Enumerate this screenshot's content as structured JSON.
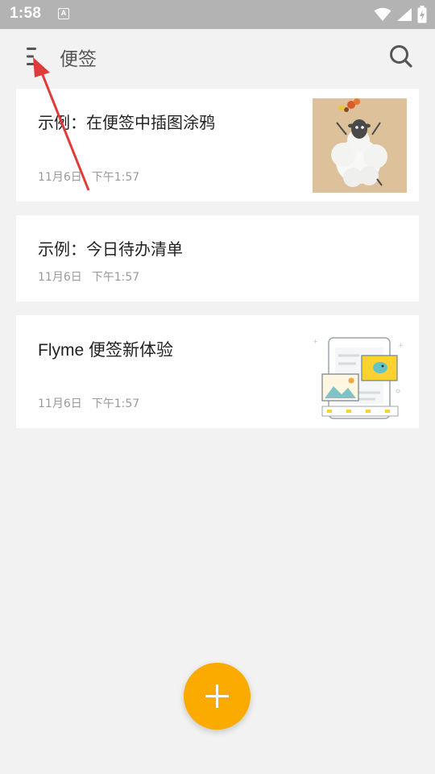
{
  "status_bar": {
    "time": "1:58",
    "notification_glyph": "A",
    "icons": [
      "wifi-icon",
      "cell-signal-icon",
      "battery-charging-icon"
    ]
  },
  "app_bar": {
    "title": "便签",
    "menu_icon": "menu-icon",
    "search_icon": "search-icon"
  },
  "notes": [
    {
      "title": "示例：在便签中插图涂鸦",
      "date": "11月6日",
      "time": "下午1:57",
      "thumbnail": "sheep-doodle-image"
    },
    {
      "title": "示例：今日待办清单",
      "date": "11月6日",
      "time": "下午1:57",
      "thumbnail": ""
    },
    {
      "title": "Flyme 便签新体验",
      "date": "11月6日",
      "time": "下午1:57",
      "thumbnail": "phone-illustration-image"
    }
  ],
  "fab": {
    "icon": "plus-icon"
  },
  "colors": {
    "accent": "#fbab00",
    "background": "#f2f2f2",
    "status_bar": "#b3b3b3",
    "annotation_arrow": "#e03b3b"
  }
}
